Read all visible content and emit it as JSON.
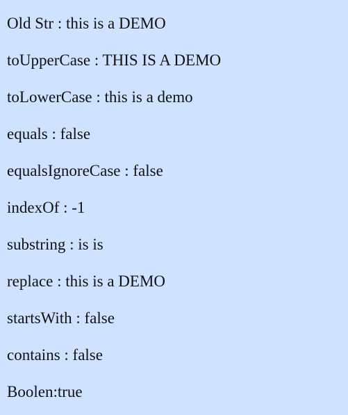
{
  "output": {
    "lines": [
      "Old Str : this is a DEMO",
      "toUpperCase : THIS IS A DEMO",
      "toLowerCase : this is a demo",
      "equals : false",
      "equalsIgnoreCase : false",
      "indexOf : -1",
      "substring : is is",
      "replace : this is a DEMO",
      "startsWith : false",
      "contains : false",
      "Boolen:true"
    ]
  },
  "colors": {
    "background": "#cfe2ff",
    "text": "#111111"
  }
}
